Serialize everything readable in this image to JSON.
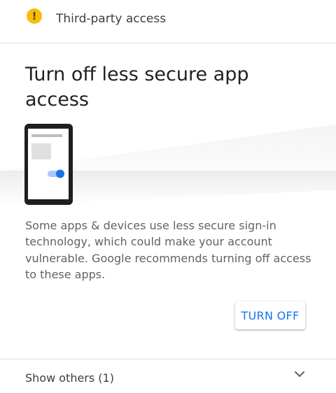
{
  "header": {
    "title": "Third-party access",
    "icon": "warning-icon",
    "icon_glyph": "!",
    "icon_color": "#fbbc04"
  },
  "card": {
    "heading": "Turn off less secure app access",
    "illustration": "phone-toggle-illustration",
    "description": "Some apps & devices use less secure sign-in technology, which could make your account vulnerable. Google recommends turning off access to these apps.",
    "button_label": "TURN OFF",
    "accent_color": "#1a73e8"
  },
  "footer": {
    "label": "Show others (1)",
    "icon": "chevron-down-icon"
  }
}
